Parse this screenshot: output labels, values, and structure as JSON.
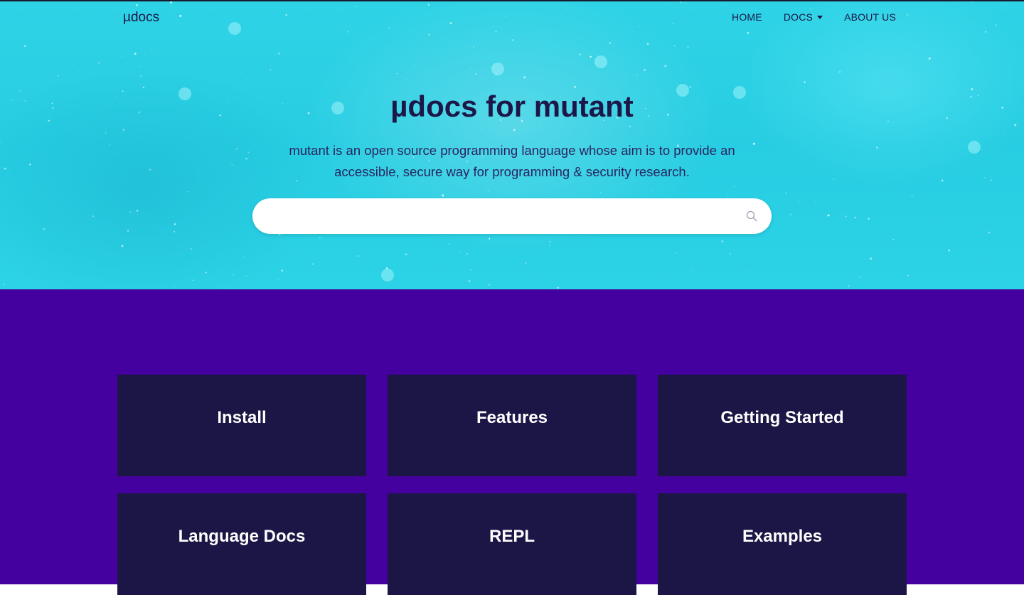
{
  "nav": {
    "brand": "µdocs",
    "links": [
      {
        "label": "HOME"
      },
      {
        "label": "DOCS",
        "has_dropdown": true
      },
      {
        "label": "ABOUT US"
      }
    ]
  },
  "hero": {
    "title": "µdocs for mutant",
    "subtitle": "mutant is an open source programming language whose aim is to provide an accessible, secure way for programming & security research.",
    "search": {
      "placeholder": "",
      "value": "",
      "icon": "search-icon"
    }
  },
  "cards": [
    {
      "title": "Install"
    },
    {
      "title": "Features"
    },
    {
      "title": "Getting Started"
    },
    {
      "title": "Language Docs"
    },
    {
      "title": "REPL"
    },
    {
      "title": "Examples"
    }
  ],
  "colors": {
    "hero_bg": "#2fd3e6",
    "text_dark": "#1c1748",
    "section_bg": "#4500a0",
    "card_bg": "#1c1646",
    "card_text": "#ffffff"
  }
}
